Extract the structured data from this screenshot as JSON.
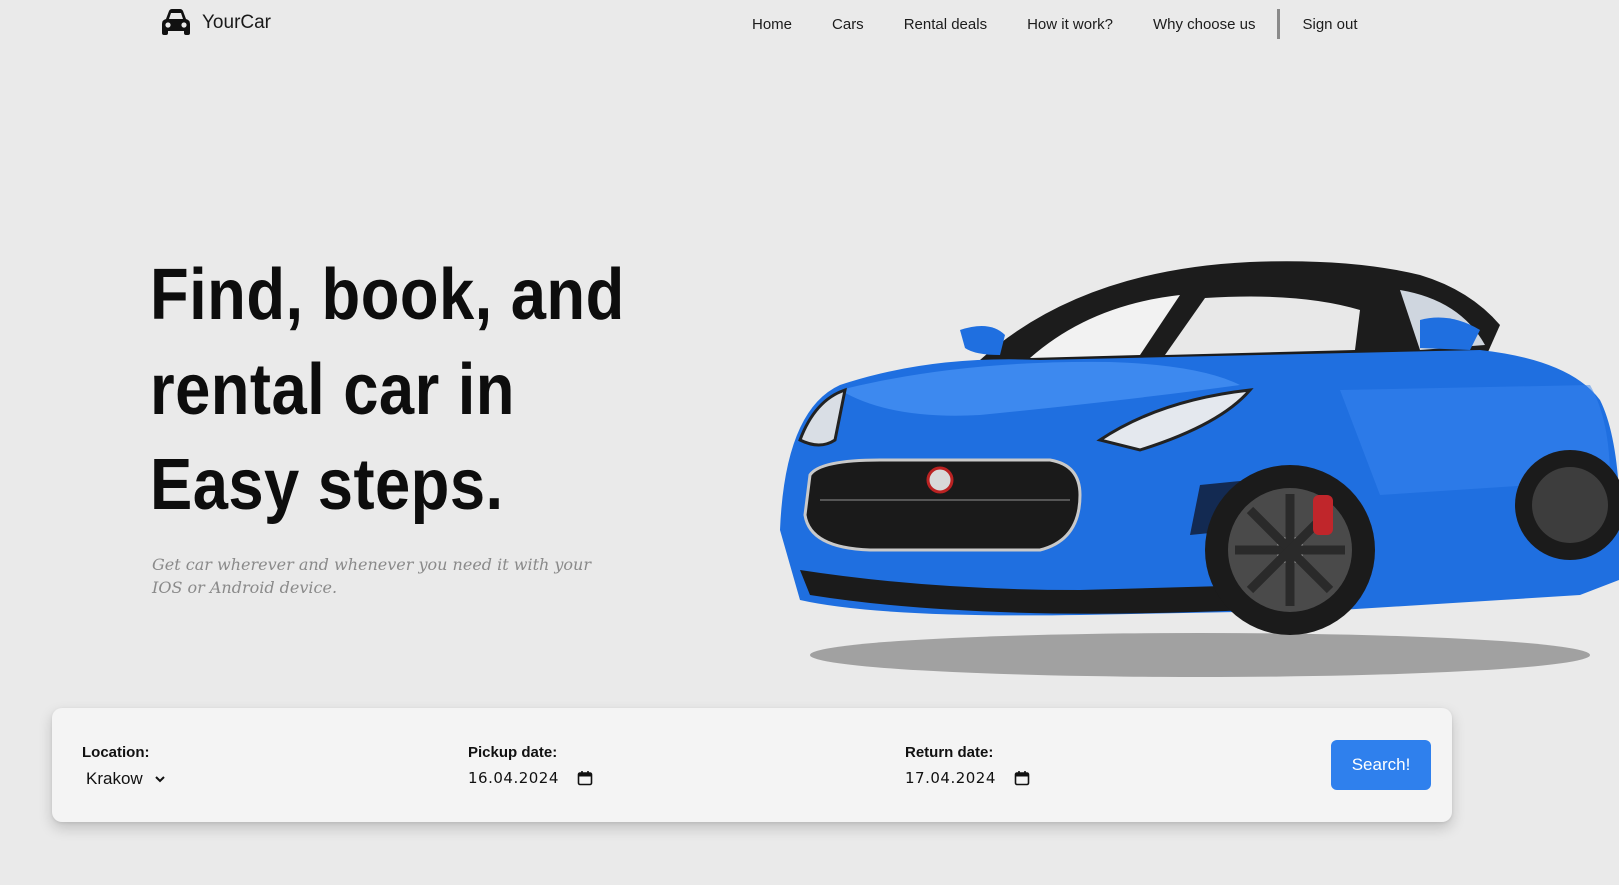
{
  "header": {
    "logo_text": "YourCar",
    "nav": [
      "Home",
      "Cars",
      "Rental deals",
      "How it work?",
      "Why choose us"
    ],
    "sign_out": "Sign out"
  },
  "hero": {
    "title_line1": "Find, book, and",
    "title_line2": "rental car in",
    "title_line3": "Easy steps.",
    "subtitle": "Get car wherever and whenever you need it with your IOS or Android device."
  },
  "search": {
    "location_label": "Location:",
    "location_value": "Krakow",
    "pickup_label": "Pickup date:",
    "pickup_value": "16.04.2024",
    "return_label": "Return date:",
    "return_value": "17.04.2024",
    "button_label": "Search!"
  },
  "colors": {
    "background": "#eaeaea",
    "accent": "#2f80ed",
    "car_body": "#1f6fe0"
  },
  "icons": [
    "car-icon",
    "chevron-down-icon",
    "calendar-icon"
  ]
}
